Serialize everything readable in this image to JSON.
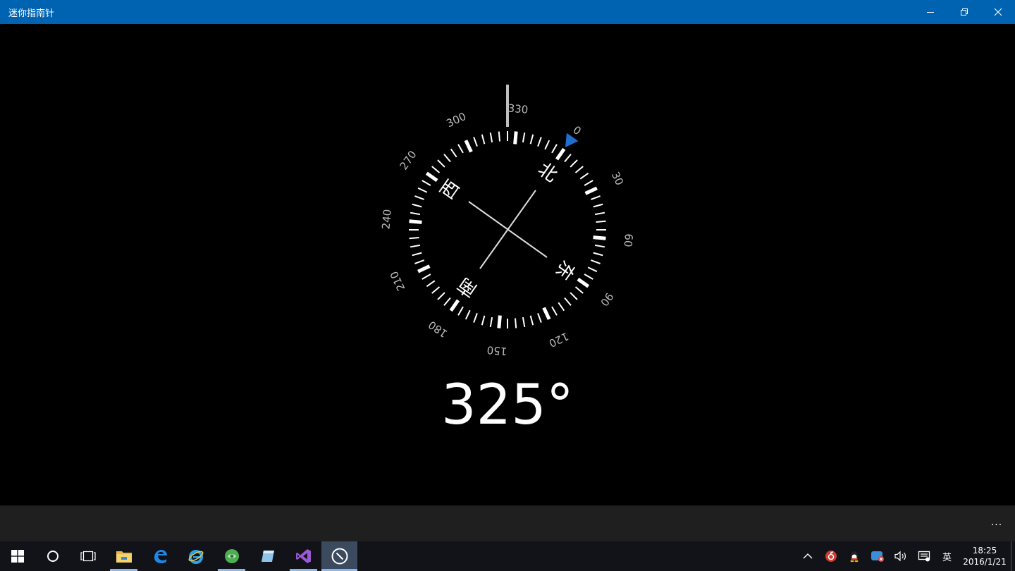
{
  "window": {
    "title": "迷你指南针",
    "title_bar_color": "#0063b1",
    "controls": [
      "minimize-icon",
      "restore-icon",
      "close-icon"
    ]
  },
  "compass": {
    "heading_value": 325,
    "heading_display": "325°",
    "ring_labels": [
      "330",
      "0",
      "30",
      "60",
      "90",
      "120",
      "150",
      "180",
      "210",
      "240",
      "270",
      "300"
    ],
    "cardinal_labels": {
      "north": "北",
      "east": "东",
      "south": "南",
      "west": "西"
    },
    "north_marker_color": "#1e6fd0",
    "ring_color": "#ffffff",
    "label_color": "#bbbbbb"
  },
  "appbar": {
    "more_label": "..."
  },
  "taskbar": {
    "buttons": [
      {
        "name": "start-button",
        "icon": "windows-logo-icon"
      },
      {
        "name": "cortana-button",
        "icon": "search-circle-icon"
      },
      {
        "name": "task-view-button",
        "icon": "task-view-icon"
      },
      {
        "name": "file-explorer-button",
        "icon": "folder-icon"
      },
      {
        "name": "edge-button",
        "icon": "edge-icon"
      },
      {
        "name": "ie-button",
        "icon": "internet-explorer-icon"
      },
      {
        "name": "green-app-button",
        "icon": "green-globe-icon"
      },
      {
        "name": "notebook-app-button",
        "icon": "notebook-icon"
      },
      {
        "name": "visual-studio-button",
        "icon": "visual-studio-icon"
      },
      {
        "name": "compass-app-button",
        "icon": "compass-icon"
      }
    ],
    "tray": {
      "icons": [
        "chevron-up-icon",
        "netease-music-icon",
        "qq-icon",
        "qq-guard-icon",
        "volume-icon",
        "action-center-icon"
      ],
      "ime_label": "英",
      "time": "18:25",
      "date": "2016/1/21"
    }
  }
}
